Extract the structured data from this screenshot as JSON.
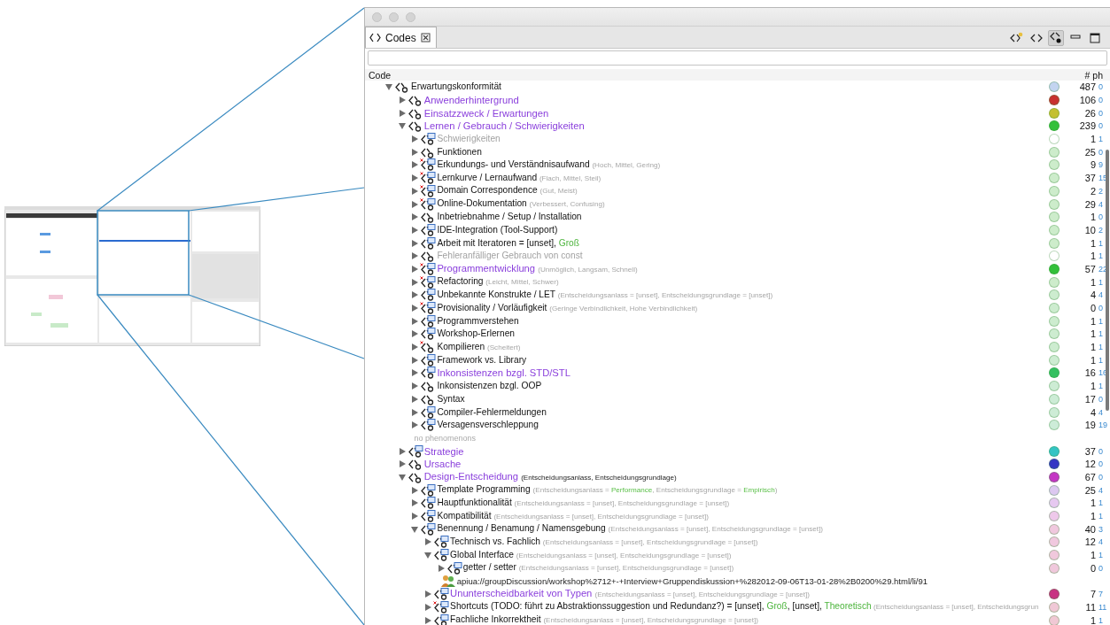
{
  "tabs": [
    {
      "label": "Codes",
      "selected": true
    }
  ],
  "table": {
    "columns": [
      "Code",
      "# ph"
    ],
    "rows": [
      {
        "kind": "code",
        "marked": false,
        "expanded": true,
        "disabled": false,
        "highlighted": false,
        "label": [
          {
            "text": "Erwartungskonformität",
            "kind": "name"
          }
        ],
        "color": "#c3d4f0",
        "count": "487",
        "ph": "0",
        "children": [
          {
            "kind": "code",
            "marked": false,
            "expanded": false,
            "disabled": false,
            "highlighted": true,
            "label": [
              {
                "text": "Anwenderhintergrund",
                "kind": "name"
              }
            ],
            "color": "#c8312f",
            "count": "106",
            "ph": "0"
          },
          {
            "kind": "code",
            "marked": false,
            "expanded": false,
            "disabled": false,
            "highlighted": true,
            "label": [
              {
                "text": "Einsatzzweck / Erwartungen",
                "kind": "name"
              }
            ],
            "color": "#c4c030",
            "count": "26",
            "ph": "0"
          },
          {
            "kind": "code",
            "marked": false,
            "expanded": true,
            "disabled": false,
            "highlighted": true,
            "label": [
              {
                "text": "Lernen / Gebrauch / Schwierigkeiten",
                "kind": "name"
              }
            ],
            "color": "#33c03a",
            "count": "239",
            "ph": "0",
            "children": [
              {
                "kind": "memo-code",
                "marked": false,
                "expanded": false,
                "disabled": true,
                "highlighted": false,
                "label": [
                  {
                    "text": "Schwierigkeiten",
                    "kind": "name"
                  }
                ],
                "color": "#ffffff",
                "count": "1",
                "ph": "1"
              },
              {
                "kind": "code",
                "marked": false,
                "expanded": false,
                "disabled": false,
                "highlighted": false,
                "label": [
                  {
                    "text": "Funktionen",
                    "kind": "name"
                  }
                ],
                "color": "#cdeccb",
                "count": "25",
                "ph": "0"
              },
              {
                "kind": "memo-code",
                "marked": true,
                "expanded": false,
                "disabled": false,
                "highlighted": false,
                "label": [
                  {
                    "text": "Erkundungs- und Verständnisaufwand ",
                    "kind": "name"
                  },
                  {
                    "text": "(Hoch, Mittel, Gering)",
                    "kind": "note"
                  }
                ],
                "color": "#cdeccb",
                "count": "9",
                "ph": "9"
              },
              {
                "kind": "memo-code",
                "marked": true,
                "expanded": false,
                "disabled": false,
                "highlighted": false,
                "label": [
                  {
                    "text": "Lernkurve / Lernaufwand ",
                    "kind": "name"
                  },
                  {
                    "text": "(Flach, Mittel, Steil)",
                    "kind": "note"
                  }
                ],
                "color": "#cdeccb",
                "count": "37",
                "ph": "15"
              },
              {
                "kind": "memo-code",
                "marked": true,
                "expanded": false,
                "disabled": false,
                "highlighted": false,
                "label": [
                  {
                    "text": "Domain Correspondence ",
                    "kind": "name"
                  },
                  {
                    "text": "(Gut, Meist)",
                    "kind": "note"
                  }
                ],
                "color": "#cdeccb",
                "count": "2",
                "ph": "2"
              },
              {
                "kind": "memo-code",
                "marked": true,
                "expanded": false,
                "disabled": false,
                "highlighted": false,
                "label": [
                  {
                    "text": "Online-Dokumentation ",
                    "kind": "name"
                  },
                  {
                    "text": "(Verbessert, Confusing)",
                    "kind": "note"
                  }
                ],
                "color": "#cdeccb",
                "count": "29",
                "ph": "4"
              },
              {
                "kind": "code",
                "marked": false,
                "expanded": false,
                "disabled": false,
                "highlighted": false,
                "label": [
                  {
                    "text": "Inbetriebnahme / Setup / Installation",
                    "kind": "name"
                  }
                ],
                "color": "#cdeccb",
                "count": "1",
                "ph": "0"
              },
              {
                "kind": "memo-code",
                "marked": false,
                "expanded": false,
                "disabled": false,
                "highlighted": false,
                "label": [
                  {
                    "text": "IDE-Integration (Tool-Support)",
                    "kind": "name"
                  }
                ],
                "color": "#cdeccb",
                "count": "10",
                "ph": "2"
              },
              {
                "kind": "memo-code",
                "marked": false,
                "expanded": false,
                "disabled": false,
                "highlighted": false,
                "label": [
                  {
                    "text": "Arbeit mit Iteratoren = [unset], ",
                    "kind": "name"
                  },
                  {
                    "text": "Groß",
                    "kind": "value"
                  }
                ],
                "color": "#cdeccb",
                "count": "1",
                "ph": "1"
              },
              {
                "kind": "code",
                "marked": false,
                "expanded": false,
                "disabled": true,
                "highlighted": false,
                "label": [
                  {
                    "text": "Fehleranfälliger Gebrauch von const",
                    "kind": "name"
                  }
                ],
                "color": "#ffffff",
                "count": "1",
                "ph": "1"
              },
              {
                "kind": "memo-code",
                "marked": true,
                "expanded": false,
                "disabled": false,
                "highlighted": true,
                "label": [
                  {
                    "text": "Programmentwicklung ",
                    "kind": "name"
                  },
                  {
                    "text": "(Unmöglich, Langsam, Schnell)",
                    "kind": "note"
                  }
                ],
                "color": "#33c03a",
                "count": "57",
                "ph": "22"
              },
              {
                "kind": "memo-code",
                "marked": true,
                "expanded": false,
                "disabled": false,
                "highlighted": false,
                "label": [
                  {
                    "text": "Refactoring ",
                    "kind": "name"
                  },
                  {
                    "text": "(Leicht, Mittel, Schwer)",
                    "kind": "note"
                  }
                ],
                "color": "#cdeccb",
                "count": "1",
                "ph": "1"
              },
              {
                "kind": "memo-code",
                "marked": false,
                "expanded": false,
                "disabled": false,
                "highlighted": false,
                "label": [
                  {
                    "text": "Unbekannte Konstrukte / LET ",
                    "kind": "name"
                  },
                  {
                    "text": "(Entscheidungsanlass = [unset], Entscheidungsgrundlage = [unset])",
                    "kind": "note"
                  }
                ],
                "color": "#cdeccf",
                "count": "4",
                "ph": "4"
              },
              {
                "kind": "memo-code",
                "marked": true,
                "expanded": false,
                "disabled": false,
                "highlighted": false,
                "label": [
                  {
                    "text": "Provisionality / Vorläufigkeit ",
                    "kind": "name"
                  },
                  {
                    "text": "(Geringe Verbindlichkeit, Hohe Verbindlichkeit)",
                    "kind": "note"
                  }
                ],
                "color": "#cdeccf",
                "count": "0",
                "ph": "0"
              },
              {
                "kind": "memo-code",
                "marked": false,
                "expanded": false,
                "disabled": false,
                "highlighted": false,
                "label": [
                  {
                    "text": "Programmverstehen",
                    "kind": "name"
                  }
                ],
                "color": "#cdeccf",
                "count": "1",
                "ph": "1"
              },
              {
                "kind": "memo-code",
                "marked": false,
                "expanded": false,
                "disabled": false,
                "highlighted": false,
                "label": [
                  {
                    "text": "Workshop-Erlernen",
                    "kind": "name"
                  }
                ],
                "color": "#cdecd0",
                "count": "1",
                "ph": "1"
              },
              {
                "kind": "code",
                "marked": true,
                "expanded": false,
                "disabled": false,
                "highlighted": false,
                "label": [
                  {
                    "text": "Kompilieren ",
                    "kind": "name"
                  },
                  {
                    "text": "(Scheitert)",
                    "kind": "note"
                  }
                ],
                "color": "#cdecd0",
                "count": "1",
                "ph": "1"
              },
              {
                "kind": "memo-code",
                "marked": false,
                "expanded": false,
                "disabled": false,
                "highlighted": false,
                "label": [
                  {
                    "text": "Framework vs. Library",
                    "kind": "name"
                  }
                ],
                "color": "#cdecd2",
                "count": "1",
                "ph": "1"
              },
              {
                "kind": "memo-code",
                "marked": false,
                "expanded": false,
                "disabled": false,
                "highlighted": true,
                "label": [
                  {
                    "text": "Inkonsistenzen bzgl. STD/STL",
                    "kind": "name"
                  }
                ],
                "color": "#33c060",
                "count": "16",
                "ph": "16"
              },
              {
                "kind": "code",
                "marked": false,
                "expanded": false,
                "disabled": false,
                "highlighted": false,
                "label": [
                  {
                    "text": "Inkonsistenzen bzgl. OOP",
                    "kind": "name"
                  }
                ],
                "color": "#cdecd4",
                "count": "1",
                "ph": "1"
              },
              {
                "kind": "code",
                "marked": false,
                "expanded": false,
                "disabled": false,
                "highlighted": false,
                "label": [
                  {
                    "text": "Syntax",
                    "kind": "name"
                  }
                ],
                "color": "#cdecd6",
                "count": "17",
                "ph": "0"
              },
              {
                "kind": "memo-code",
                "marked": false,
                "expanded": false,
                "disabled": false,
                "highlighted": false,
                "label": [
                  {
                    "text": "Compiler-Fehlermeldungen",
                    "kind": "name"
                  }
                ],
                "color": "#cdecd6",
                "count": "4",
                "ph": "4"
              },
              {
                "kind": "memo-code",
                "marked": false,
                "expanded": false,
                "disabled": false,
                "highlighted": false,
                "label": [
                  {
                    "text": "Versagensverschleppung",
                    "kind": "name"
                  }
                ],
                "color": "#cdecd8",
                "count": "19",
                "ph": "19"
              },
              {
                "kind": "note",
                "text": "no phenomenons"
              }
            ]
          },
          {
            "kind": "memo-code",
            "marked": false,
            "expanded": false,
            "disabled": false,
            "highlighted": true,
            "label": [
              {
                "text": "Strategie",
                "kind": "name"
              }
            ],
            "color": "#33c4c4",
            "count": "37",
            "ph": "0"
          },
          {
            "kind": "code",
            "marked": false,
            "expanded": false,
            "disabled": false,
            "highlighted": true,
            "label": [
              {
                "text": "Ursache",
                "kind": "name"
              }
            ],
            "color": "#3535c4",
            "count": "12",
            "ph": "0"
          },
          {
            "kind": "code",
            "marked": false,
            "expanded": true,
            "disabled": false,
            "highlighted": true,
            "label": [
              {
                "text": "Design-Entscheidung ",
                "kind": "name"
              },
              {
                "text": "(Entscheidungsanlass, Entscheidungsgrundlage)",
                "kind": "annotation"
              }
            ],
            "color": "#c435c4",
            "count": "67",
            "ph": "0",
            "children": [
              {
                "kind": "memo-code",
                "marked": false,
                "expanded": false,
                "disabled": false,
                "highlighted": false,
                "label": [
                  {
                    "text": "Template Programming ",
                    "kind": "name"
                  },
                  {
                    "text": "(Entscheidungsanlass = ",
                    "kind": "note"
                  },
                  {
                    "text": "Performance",
                    "kind": "note-value"
                  },
                  {
                    "text": ", Entscheidungsgrundlage = ",
                    "kind": "note"
                  },
                  {
                    "text": "Empirisch",
                    "kind": "note-value"
                  },
                  {
                    "text": ")",
                    "kind": "note"
                  }
                ],
                "color": "#dcc8f0",
                "count": "25",
                "ph": "4"
              },
              {
                "kind": "memo-code",
                "marked": false,
                "expanded": false,
                "disabled": false,
                "highlighted": false,
                "label": [
                  {
                    "text": "Hauptfunktionalität ",
                    "kind": "name"
                  },
                  {
                    "text": "(Entscheidungsanlass = [unset], Entscheidungsgrundlage = [unset])",
                    "kind": "note"
                  }
                ],
                "color": "#e6c8f0",
                "count": "1",
                "ph": "1"
              },
              {
                "kind": "memo-code",
                "marked": false,
                "expanded": false,
                "disabled": false,
                "highlighted": false,
                "label": [
                  {
                    "text": "Kompatibilität ",
                    "kind": "name"
                  },
                  {
                    "text": "(Entscheidungsanlass = [unset], Entscheidungsgrundlage = [unset])",
                    "kind": "note"
                  }
                ],
                "color": "#eec8ea",
                "count": "1",
                "ph": "1"
              },
              {
                "kind": "memo-code",
                "marked": false,
                "expanded": true,
                "disabled": false,
                "highlighted": false,
                "label": [
                  {
                    "text": "Benennung / Benamung / Namensgebung ",
                    "kind": "name"
                  },
                  {
                    "text": "(Entscheidungsanlass = [unset], Entscheidungsgrundlage = [unset])",
                    "kind": "note"
                  }
                ],
                "color": "#f0c8de",
                "count": "40",
                "ph": "3",
                "children": [
                  {
                    "kind": "memo-code",
                    "marked": false,
                    "expanded": false,
                    "disabled": false,
                    "highlighted": false,
                    "label": [
                      {
                        "text": "Technisch vs. Fachlich ",
                        "kind": "name"
                      },
                      {
                        "text": "(Entscheidungsanlass = [unset], Entscheidungsgrundlage = [unset])",
                        "kind": "note"
                      }
                    ],
                    "color": "#f0c8de",
                    "count": "12",
                    "ph": "4"
                  },
                  {
                    "kind": "memo-code",
                    "marked": false,
                    "expanded": true,
                    "disabled": false,
                    "highlighted": false,
                    "label": [
                      {
                        "text": "Global Interface ",
                        "kind": "name"
                      },
                      {
                        "text": "(Entscheidungsanlass = [unset], Entscheidungsgrundlage = [unset])",
                        "kind": "note"
                      }
                    ],
                    "color": "#f0c8dc",
                    "count": "1",
                    "ph": "1",
                    "children": [
                      {
                        "kind": "memo-code",
                        "marked": false,
                        "expanded": false,
                        "disabled": false,
                        "highlighted": false,
                        "label": [
                          {
                            "text": "getter / setter ",
                            "kind": "name"
                          },
                          {
                            "text": "(Entscheidungsanlass = [unset], Entscheidungsgrundlage = [unset])",
                            "kind": "note"
                          }
                        ],
                        "color": "#f0c8dc",
                        "count": "0",
                        "ph": "0"
                      },
                      {
                        "kind": "phenomenon",
                        "text": "apiua://groupDiscussion/workshop%2712+-+Interview+Gruppendiskussion+%282012-09-06T13-01-28%2B0200%29.html/li/91"
                      }
                    ]
                  },
                  {
                    "kind": "memo-code",
                    "marked": false,
                    "expanded": false,
                    "disabled": false,
                    "highlighted": true,
                    "label": [
                      {
                        "text": "Ununterscheidbarkeit von Typen ",
                        "kind": "name"
                      },
                      {
                        "text": "(Entscheidungsanlass = [unset], Entscheidungsgrundlage = [unset])",
                        "kind": "note"
                      }
                    ],
                    "color": "#c83282",
                    "count": "7",
                    "ph": "7"
                  },
                  {
                    "kind": "memo-code",
                    "marked": true,
                    "expanded": false,
                    "disabled": false,
                    "highlighted": false,
                    "label": [
                      {
                        "text": "Shortcuts (TODO: führt zu Abstraktionssuggestion und Redundanz?) = [unset], ",
                        "kind": "name"
                      },
                      {
                        "text": "Groß",
                        "kind": "value"
                      },
                      {
                        "text": ", [unset], ",
                        "kind": "name"
                      },
                      {
                        "text": "Theoretisch",
                        "kind": "value"
                      },
                      {
                        "text": " (Entscheidungsanlass = [unset], Entscheidungsgrun",
                        "kind": "note"
                      }
                    ],
                    "color": "#f0c8d6",
                    "count": "11",
                    "ph": "11"
                  },
                  {
                    "kind": "memo-code",
                    "marked": false,
                    "expanded": false,
                    "disabled": false,
                    "highlighted": false,
                    "label": [
                      {
                        "text": "Fachliche Inkorrektheit ",
                        "kind": "name"
                      },
                      {
                        "text": "(Entscheidungsanlass = [unset], Entscheidungsgrundlage = [unset])",
                        "kind": "note"
                      }
                    ],
                    "color": "#f0c8d4",
                    "count": "1",
                    "ph": "1"
                  }
                ]
              }
            ]
          }
        ]
      }
    ]
  }
}
